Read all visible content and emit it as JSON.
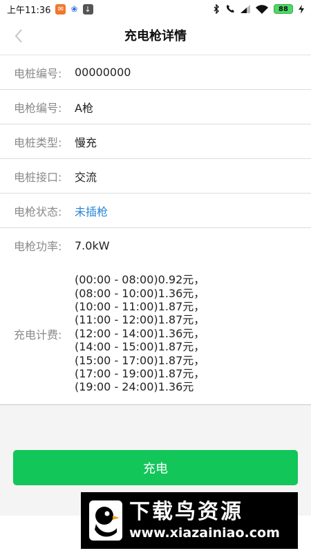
{
  "status_bar": {
    "time": "上午11:36",
    "battery": "88",
    "icons": [
      "notification-icon",
      "paw-icon",
      "download-icon",
      "bluetooth-icon",
      "phone-icon",
      "signal-icon",
      "wifi-icon",
      "battery-icon",
      "charging-icon"
    ]
  },
  "header": {
    "title": "充电枪详情",
    "back_icon": "chevron-left-icon"
  },
  "details": [
    {
      "label": "电桩编号:",
      "value": "00000000"
    },
    {
      "label": "电枪编号:",
      "value": "A枪"
    },
    {
      "label": "电桩类型:",
      "value": "慢充"
    },
    {
      "label": "电桩接口:",
      "value": "交流"
    },
    {
      "label": "电枪状态:",
      "value": "未插枪"
    },
    {
      "label": "电枪功率:",
      "value": "7.0kW"
    }
  ],
  "fee": {
    "label": "充电计费:",
    "lines": [
      "(00:00 - 08:00)0.92元，",
      "(08:00 - 10:00)1.36元，",
      "(10:00 - 11:00)1.87元，",
      "(11:00 - 12:00)1.87元，",
      "(12:00 - 14:00)1.36元，",
      "(14:00 - 15:00)1.87元，",
      "(15:00 - 17:00)1.87元，",
      "(17:00 - 19:00)1.87元，",
      "(19:00 - 24:00)1.36元"
    ]
  },
  "actions": {
    "charge_label": "充电"
  },
  "watermark": {
    "title": "下载鸟资源",
    "url": "www.xiazainiao.com"
  },
  "colors": {
    "accent_green": "#12c65a",
    "status_link_blue": "#2b84d8"
  }
}
